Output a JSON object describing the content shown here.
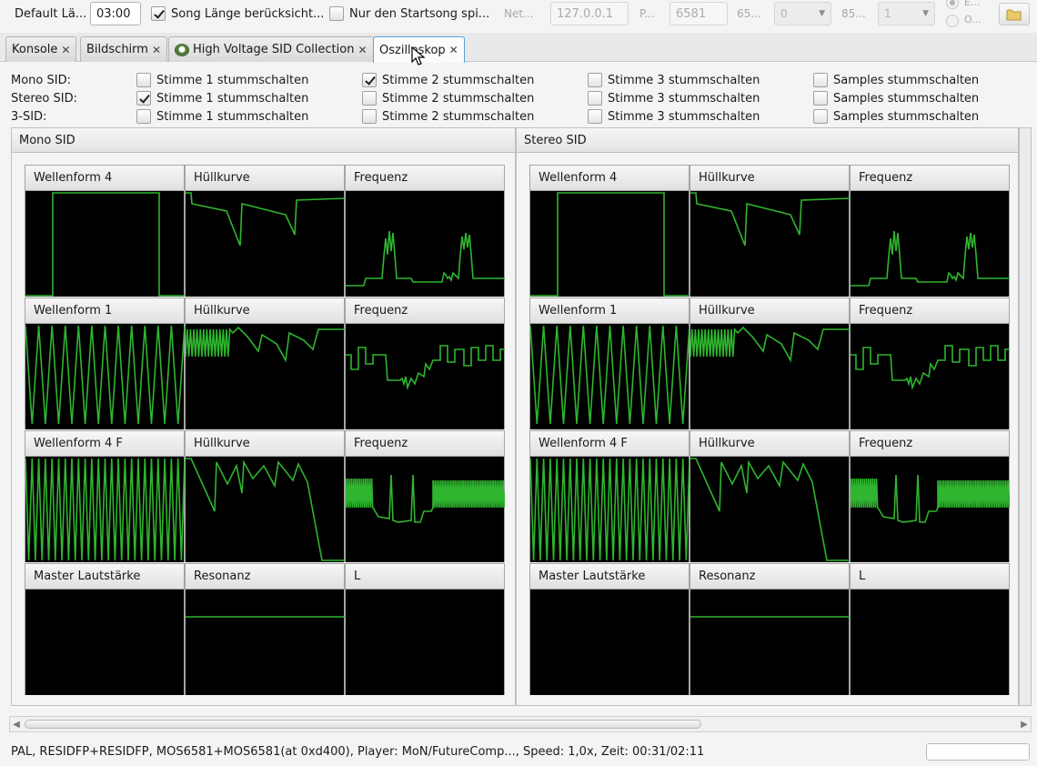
{
  "toolbar": {
    "default_length_label": "Default Lä...",
    "default_length_value": "03:00",
    "song_length_label": "Song Länge berücksicht...",
    "song_length_checked": true,
    "startsong_label": "Nur den Startsong spi...",
    "startsong_checked": false,
    "net_label": "Net...",
    "ip_value": "127.0.0.1",
    "port_label": "P...",
    "port_value": "6581",
    "sid1_label": "65...",
    "sid1_value": "0",
    "sid2_label": "85...",
    "sid2_value": "1",
    "radio1_label": "E...",
    "radio2_label": "O...",
    "folder_icon": "folder-icon"
  },
  "tabs": [
    {
      "label": "Konsole",
      "active": false
    },
    {
      "label": "Bildschirm",
      "active": false
    },
    {
      "label": "High Voltage SID Collection",
      "active": false,
      "icon": "hvsc-icon"
    },
    {
      "label": "Oszilloskop",
      "active": true
    }
  ],
  "mute": {
    "rows": [
      {
        "label": "Mono SID:",
        "checks": [
          false,
          true,
          false,
          false
        ]
      },
      {
        "label": "Stereo SID:",
        "checks": [
          true,
          false,
          false,
          false
        ]
      },
      {
        "label": "3-SID:",
        "checks": [
          false,
          false,
          false,
          false
        ]
      }
    ],
    "columns": [
      "Stimme 1 stummschalten",
      "Stimme 2 stummschalten",
      "Stimme 3 stummschalten",
      "Samples stummschalten"
    ]
  },
  "panels": [
    {
      "title": "Mono SID",
      "cells": [
        [
          "Wellenform 4",
          "Hüllkurve",
          "Frequenz"
        ],
        [
          "Wellenform 1",
          "Hüllkurve",
          "Frequenz"
        ],
        [
          "Wellenform 4 F",
          "Hüllkurve",
          "Frequenz"
        ],
        [
          "Master Lautstärke",
          "Resonanz",
          "L"
        ]
      ]
    },
    {
      "title": "Stereo SID",
      "cells": [
        [
          "Wellenform 4",
          "Hüllkurve",
          "Frequenz"
        ],
        [
          "Wellenform 1",
          "Hüllkurve",
          "Frequenz"
        ],
        [
          "Wellenform 4 F",
          "Hüllkurve",
          "Frequenz"
        ],
        [
          "Master Lautstärke",
          "Resonanz",
          "L"
        ]
      ]
    }
  ],
  "colors": {
    "scope_bg": "#000000",
    "scope_trace": "#2fb52f",
    "active_tab_border": "#5a9fd4"
  },
  "status": {
    "text": "PAL, RESIDFP+RESIDFP, MOS6581+MOS6581(at 0xd400), Player: MoN/FutureComp..., Speed: 1,0x, Zeit: 00:31/02:11"
  }
}
